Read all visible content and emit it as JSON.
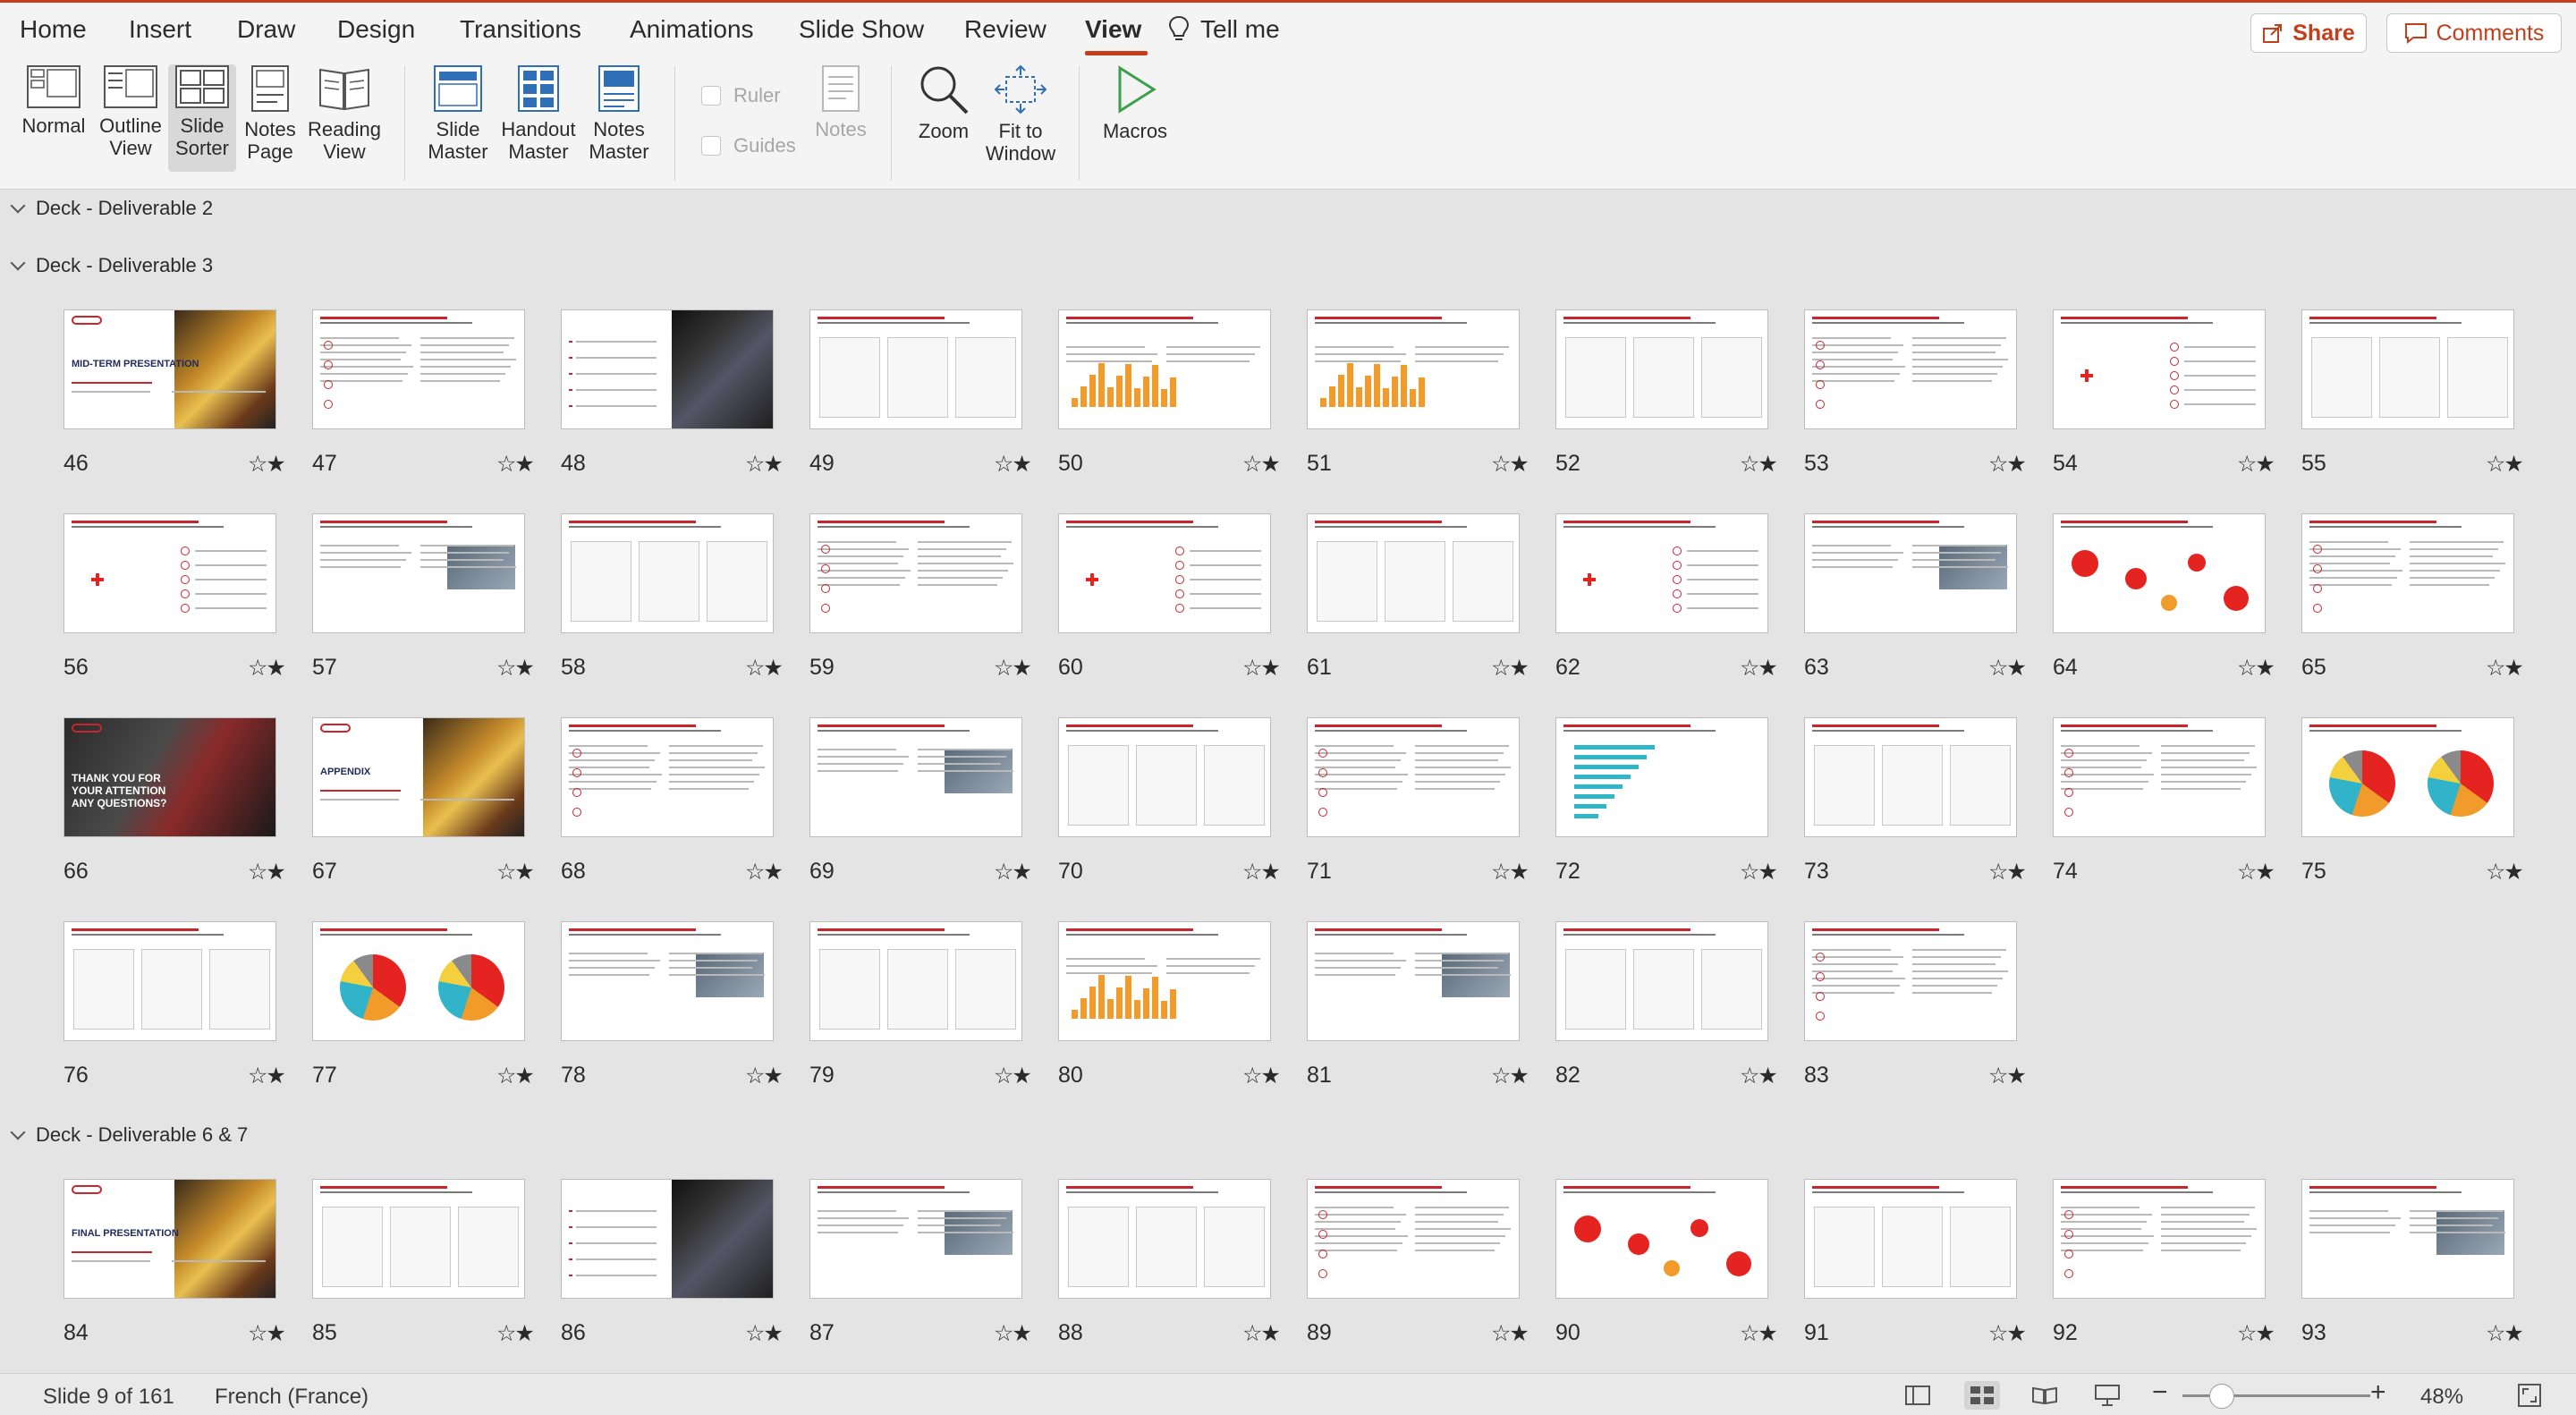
{
  "tabs": [
    {
      "label": "Home",
      "active": false
    },
    {
      "label": "Insert",
      "active": false
    },
    {
      "label": "Draw",
      "active": false
    },
    {
      "label": "Design",
      "active": false
    },
    {
      "label": "Transitions",
      "active": false
    },
    {
      "label": "Animations",
      "active": false
    },
    {
      "label": "Slide Show",
      "active": false
    },
    {
      "label": "Review",
      "active": false
    },
    {
      "label": "View",
      "active": true
    }
  ],
  "tell_me": "Tell me",
  "share_label": "Share",
  "comments_label": "Comments",
  "ribbon": {
    "normal": "Normal",
    "outline_view": [
      "Outline",
      "View"
    ],
    "slide_sorter": [
      "Slide",
      "Sorter"
    ],
    "notes_page": [
      "Notes",
      "Page"
    ],
    "reading_view": [
      "Reading",
      "View"
    ],
    "slide_master": [
      "Slide",
      "Master"
    ],
    "handout_master": [
      "Handout",
      "Master"
    ],
    "notes_master": [
      "Notes",
      "Master"
    ],
    "ruler": "Ruler",
    "guides": "Guides",
    "notes": "Notes",
    "zoom": "Zoom",
    "fit_to_window": [
      "Fit to",
      "Window"
    ],
    "macros": "Macros"
  },
  "sections": [
    {
      "name": "Deck - Deliverable 2"
    },
    {
      "name": "Deck - Deliverable 3"
    },
    {
      "name": "Deck - Deliverable 6 & 7"
    }
  ],
  "slide_texts": {
    "s46_title": "MID-TERM PRESENTATION",
    "s66_title": "THANK YOU FOR YOUR ATTENTION ANY QUESTIONS?",
    "s67_title": "APPENDIX",
    "s84_title": "FINAL PRESENTATION"
  },
  "rows": [
    {
      "section": 1,
      "slides": [
        "46",
        "47",
        "48",
        "49",
        "50",
        "51",
        "52",
        "53",
        "54",
        "55"
      ]
    },
    {
      "section": 1,
      "slides": [
        "56",
        "57",
        "58",
        "59",
        "60",
        "61",
        "62",
        "63",
        "64",
        "65"
      ]
    },
    {
      "section": 1,
      "slides": [
        "66",
        "67",
        "68",
        "69",
        "70",
        "71",
        "72",
        "73",
        "74",
        "75"
      ]
    },
    {
      "section": 1,
      "slides": [
        "76",
        "77",
        "78",
        "79",
        "80",
        "81",
        "82",
        "83"
      ]
    },
    {
      "section": 2,
      "slides": [
        "84",
        "85",
        "86",
        "87",
        "88",
        "89",
        "90",
        "91",
        "92",
        "93"
      ]
    }
  ],
  "status": {
    "slide_info": "Slide 9 of 161",
    "language": "French (France)",
    "zoom": "48%"
  },
  "colors": {
    "accent": "#c43e1c",
    "slide_red": "#c9252c"
  }
}
